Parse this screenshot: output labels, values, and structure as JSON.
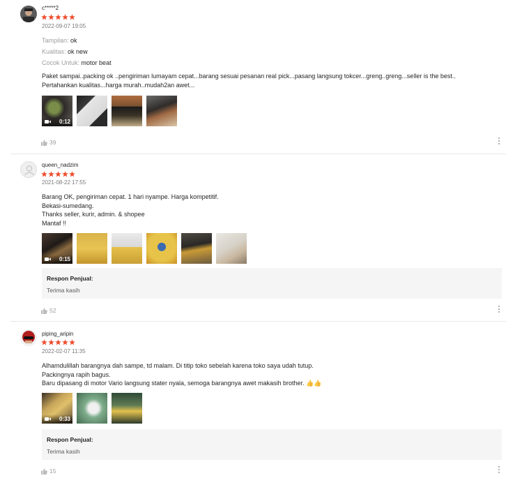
{
  "colors": {
    "star": "#ee4d2d",
    "seller_bg": "#f5f5f5"
  },
  "reviews": [
    {
      "username": "c*****2",
      "rating": 5,
      "date": "2022-09-07 19:05",
      "attributes": [
        {
          "key": "Tampilan:",
          "value": "ok"
        },
        {
          "key": "Kualitas:",
          "value": "ok new"
        },
        {
          "key": "Cocok Untuk:",
          "value": "motor beat"
        }
      ],
      "text": "Paket sampai..packing ok ..pengiriman lumayam cepat...barang sesuai pesanan  real pick...pasang langsung tokcer...greng..greng...seller is the best..\nPertahankan kualitas...harga murah..mudah2an awet...",
      "video_duration": "0:12",
      "media_count": 4,
      "likes": "39"
    },
    {
      "username": "queen_nadzim",
      "rating": 5,
      "date": "2021-08-22 17:55",
      "text": "Barang OK, pengiriman cepat. 1 hari nyampe. Harga kompetitif.\nBekasi-sumedang.\nThanks seller, kurir, admin. & shopee\nMantaf !!",
      "video_duration": "0:15",
      "media_count": 6,
      "seller_response_title": "Respon Penjual:",
      "seller_response": "Terima kasih",
      "likes": "52"
    },
    {
      "username": "piping_aripin",
      "rating": 5,
      "date": "2022-02-07 11:35",
      "text": "Alhamdulillah barangnya dah sampe, td malam. Di titip toko sebelah karena toko saya udah tutup.\nPackingnya rapih bagus.\nBaru dipasang di motor Vario langsung stater nyala, semoga barangnya awet makasih brother. 👍👍",
      "video_duration": "0:33",
      "media_count": 3,
      "seller_response_title": "Respon Penjual:",
      "seller_response": "Terima kasih",
      "likes": "15"
    }
  ]
}
